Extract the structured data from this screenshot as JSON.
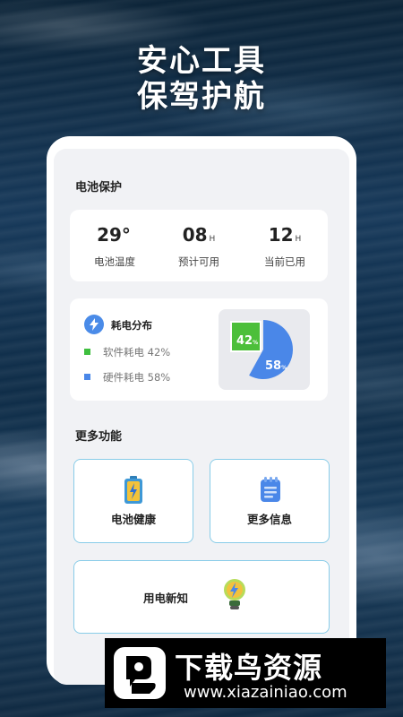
{
  "hero": {
    "line1": "安心工具",
    "line2": "保驾护航"
  },
  "battery_section": {
    "title": "电池保护",
    "stats": [
      {
        "value": "29°",
        "unit": "",
        "label": "电池温度"
      },
      {
        "value": "08",
        "unit": "H",
        "label": "预计可用"
      },
      {
        "value": "12",
        "unit": "H",
        "label": "当前已用"
      }
    ]
  },
  "distribution": {
    "title": "耗电分布",
    "icon": "lightning-bolt-icon",
    "legend": [
      {
        "label": "软件耗电 42%",
        "color": "#3fbf3f"
      },
      {
        "label": "硬件耗电 58%",
        "color": "#4a87e8"
      }
    ],
    "pie": {
      "software": {
        "value": 42,
        "display": "42",
        "unit": "%",
        "color": "#4cbf3a"
      },
      "hardware": {
        "value": 58,
        "display": "58",
        "unit": "%",
        "color": "#4a87e8"
      }
    }
  },
  "more_section": {
    "title": "更多功能",
    "items": [
      {
        "label": "电池健康",
        "icon": "battery-health-icon"
      },
      {
        "label": "更多信息",
        "icon": "notepad-icon"
      },
      {
        "label": "用电新知",
        "icon": "lightbulb-icon"
      }
    ]
  },
  "watermark": {
    "title": "下载鸟资源",
    "url": "www.xiazainiao.com"
  }
}
